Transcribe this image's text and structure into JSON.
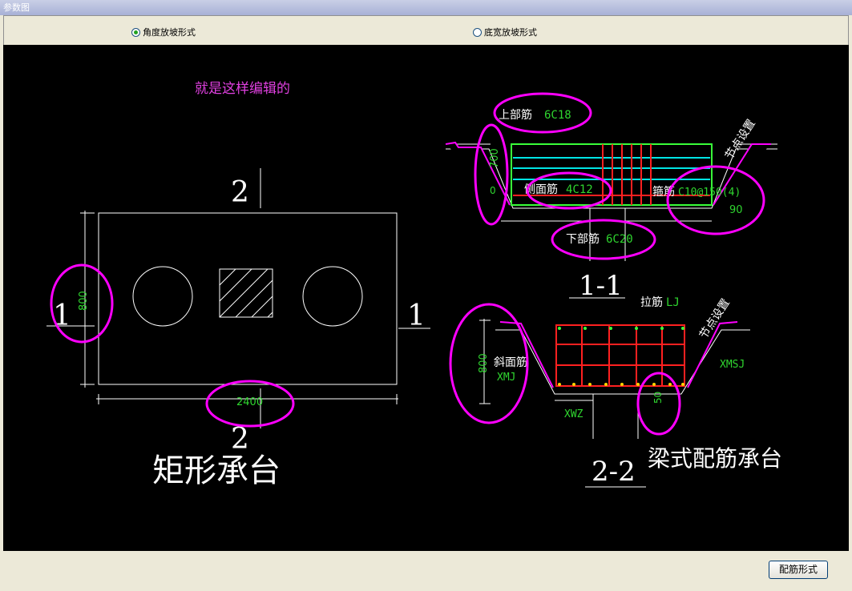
{
  "window": {
    "title": "参数图"
  },
  "options": {
    "angle_slope": {
      "label": "角度放坡形式",
      "selected": true
    },
    "width_slope": {
      "label": "底宽放坡形式",
      "selected": false
    }
  },
  "drawing": {
    "note": "就是这样编辑的",
    "left": {
      "title": "矩形承台",
      "section_top": "2",
      "section_bottom": "2",
      "section_left": "1",
      "section_right": "1",
      "height_dim": "800",
      "width_dim": "2400"
    },
    "section11": {
      "title": "1-1",
      "top_bar_label": "上部筋",
      "top_bar_value": "6C18",
      "side_bar_label": "侧面筋",
      "side_bar_value": "4C12",
      "stirrup_label": "箍筋",
      "stirrup_value": "C10@150(4)",
      "bottom_bar_label": "下部筋",
      "bottom_bar_value": "6C20",
      "height_dim": "700",
      "small_dim": "0",
      "angle": "90",
      "node_setting": "节点设置"
    },
    "section22": {
      "title": "2-2",
      "tie_label": "拉筋",
      "tie_value": "LJ",
      "slope_bar_label": "斜面筋",
      "slope_bar_value": "XMJ",
      "xwz": "XWZ",
      "xmsj": "XMSJ",
      "height_dim": "800",
      "small_dim": "50",
      "node_setting": "节点设置"
    },
    "right_title": "梁式配筋承台"
  },
  "buttons": {
    "rebar_form": "配筋形式"
  },
  "colors": {
    "canvas": "#000000",
    "highlight": "#ff00ff",
    "dim_text": "#00ff00",
    "rebar": "#ff2020",
    "cyan": "#00ffff"
  }
}
